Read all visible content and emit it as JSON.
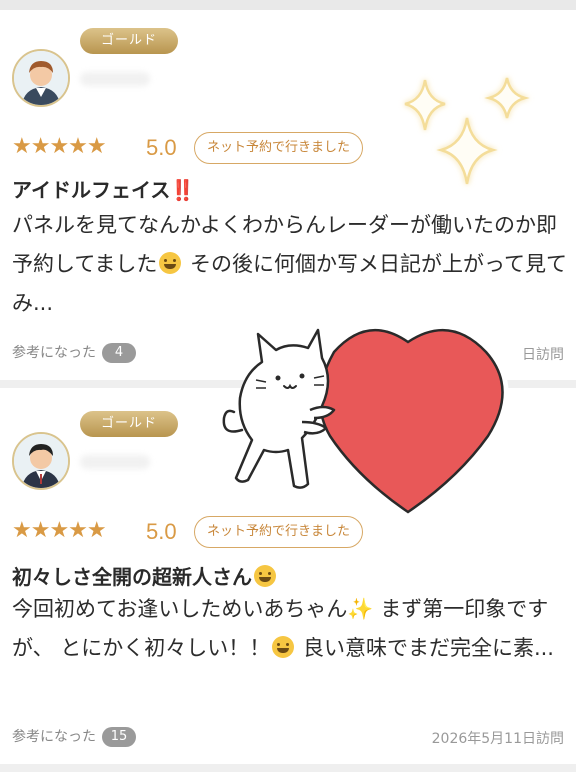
{
  "reviews": [
    {
      "badge": "ゴールド",
      "rating_text": "5.0",
      "rating": 5,
      "tag": "ネット予約で行きました",
      "title": "アイドルフェイス",
      "title_suffix": "‼️",
      "body_1": "パネルを見てなんかよくわからんレーダーが働いたのか即予約してました",
      "body_2": " その後に何個か写メ日記が上がって見てみ...",
      "helpful_label": "参考になった",
      "helpful_count": "4",
      "visit": "日訪問"
    },
    {
      "badge": "ゴールド",
      "rating_text": "5.0",
      "rating": 5,
      "tag": "ネット予約で行きました",
      "title": "初々しさ全開の超新人さん",
      "body_1": "今回初めてお逢いしためいあちゃん",
      "body_2": " まず第一印象ですが、 とにかく初々しい！！",
      "body_3": " 良い意味でまだ完全に素...",
      "helpful_label": "参考になった",
      "helpful_count": "15",
      "visit": "2026年5月11日訪問"
    }
  ],
  "colors": {
    "gold": "#c79a4e",
    "star": "#d99a45",
    "heart": "#e85858"
  }
}
